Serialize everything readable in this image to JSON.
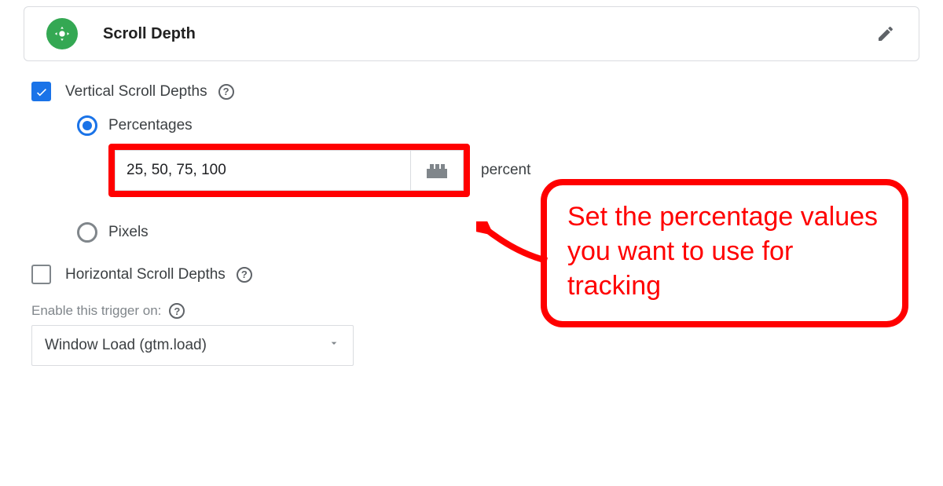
{
  "header": {
    "title": "Scroll Depth"
  },
  "vertical": {
    "label": "Vertical Scroll Depths",
    "percentages_label": "Percentages",
    "input_value": "25, 50, 75, 100",
    "suffix": "percent",
    "pixels_label": "Pixels"
  },
  "horizontal": {
    "label": "Horizontal Scroll Depths"
  },
  "enable": {
    "hint": "Enable this trigger on:",
    "selected": "Window Load (gtm.load)"
  },
  "callout": {
    "text": "Set the percentage values you want to use for tracking"
  },
  "help_glyph": "?"
}
